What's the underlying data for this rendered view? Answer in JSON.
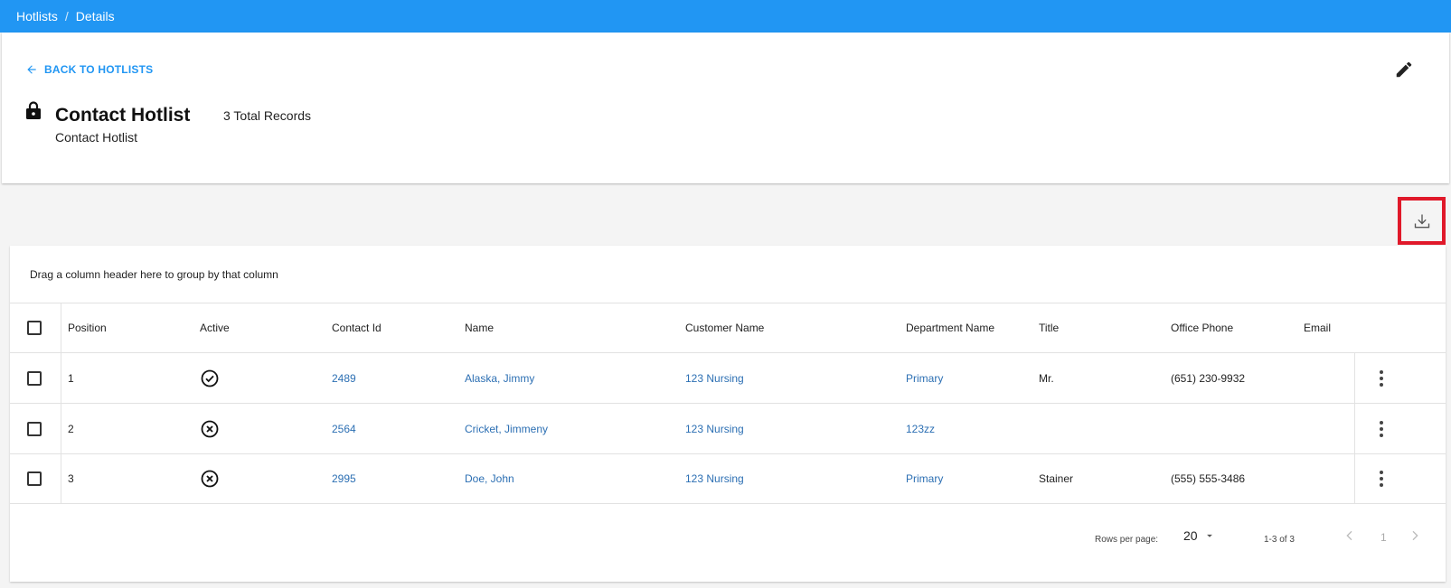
{
  "breadcrumb": [
    "Hotlists",
    "Details"
  ],
  "header": {
    "back_label": "BACK TO HOTLISTS",
    "title": "Contact Hotlist",
    "records": "3 Total Records",
    "subtitle": "Contact Hotlist"
  },
  "grid": {
    "group_hint": "Drag a column header here to group by that column",
    "columns": [
      "Position",
      "Active",
      "Contact Id",
      "Name",
      "Customer Name",
      "Department Name",
      "Title",
      "Office Phone",
      "Email"
    ],
    "rows": [
      {
        "position": "1",
        "active": true,
        "contact_id": "2489",
        "name": "Alaska, Jimmy",
        "customer": "123 Nursing",
        "department": "Primary",
        "title": "Mr.",
        "phone": "(651) 230-9932",
        "email": ""
      },
      {
        "position": "2",
        "active": false,
        "contact_id": "2564",
        "name": "Cricket, Jimmeny",
        "customer": "123 Nursing",
        "department": "123zz",
        "title": "",
        "phone": "",
        "email": ""
      },
      {
        "position": "3",
        "active": false,
        "contact_id": "2995",
        "name": "Doe, John",
        "customer": "123 Nursing",
        "department": "Primary",
        "title": "Stainer",
        "phone": "(555) 555-3486",
        "email": ""
      }
    ]
  },
  "pager": {
    "rows_per_page_label": "Rows per page:",
    "rows_per_page": "20",
    "range": "1-3 of 3",
    "page": "1"
  },
  "icons": {
    "back": "arrow-left-icon",
    "edit": "pencil-icon",
    "lock": "lock-icon",
    "download": "download-icon",
    "active_true": "check-circle-icon",
    "active_false": "x-circle-icon",
    "row_menu": "more-vert-icon"
  },
  "colors": {
    "accent": "#2196f3",
    "link": "#2c6fb3",
    "highlight": "#e0192a"
  }
}
